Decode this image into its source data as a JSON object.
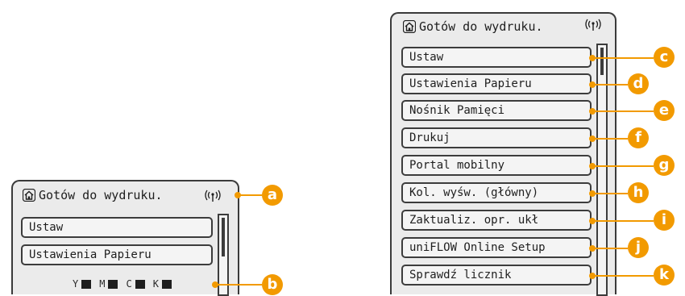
{
  "accent_color": "#f29a00",
  "small_panel": {
    "status": "Gotów do wydruku.",
    "items": [
      {
        "label": "Ustaw"
      },
      {
        "label": "Ustawienia Papieru"
      }
    ],
    "toner": [
      {
        "letter": "Y"
      },
      {
        "letter": "M"
      },
      {
        "letter": "C"
      },
      {
        "letter": "K"
      }
    ]
  },
  "big_panel": {
    "status": "Gotów do wydruku.",
    "items": [
      {
        "label": "Ustaw"
      },
      {
        "label": "Ustawienia Papieru"
      },
      {
        "label": "Nośnik Pamięci"
      },
      {
        "label": "Drukuj"
      },
      {
        "label": "Portal mobilny"
      },
      {
        "label": "Kol. wyśw. (główny)"
      },
      {
        "label": "Zaktualiz. opr. ukł"
      },
      {
        "label": "uniFLOW Online Setup"
      },
      {
        "label": "Sprawdź licznik"
      }
    ]
  },
  "callouts": {
    "a": "a",
    "b": "b",
    "c": "c",
    "d": "d",
    "e": "e",
    "f": "f",
    "g": "g",
    "h": "h",
    "i": "i",
    "j": "j",
    "k": "k"
  }
}
